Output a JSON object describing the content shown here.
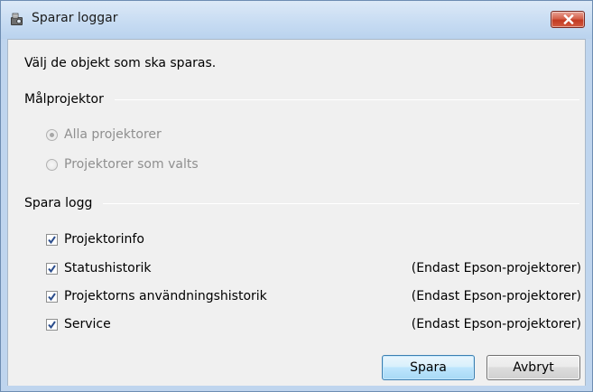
{
  "window": {
    "title": "Sparar loggar",
    "icon": "projector-save-icon",
    "close_icon": "close-icon"
  },
  "instruction": "Välj de objekt som ska sparas.",
  "target_group": {
    "label": "Målprojektor",
    "options": [
      {
        "label": "Alla projektorer",
        "selected": true,
        "enabled": false
      },
      {
        "label": "Projektorer som valts",
        "selected": false,
        "enabled": false
      }
    ]
  },
  "log_group": {
    "label": "Spara logg",
    "items": [
      {
        "label": "Projektorinfo",
        "checked": true,
        "note": ""
      },
      {
        "label": "Statushistorik",
        "checked": true,
        "note": "(Endast Epson-projektorer)"
      },
      {
        "label": "Projektorns användningshistorik",
        "checked": true,
        "note": "(Endast Epson-projektorer)"
      },
      {
        "label": "Service",
        "checked": true,
        "note": "(Endast Epson-projektorer)"
      }
    ]
  },
  "buttons": {
    "save": "Spara",
    "cancel": "Avbryt"
  },
  "colors": {
    "titlebar": "#c6dbf2",
    "close_button": "#c94a32",
    "client_background": "#f0f0f0",
    "checkmark": "#2b4d8c",
    "default_button_border": "#3c7fb1"
  }
}
